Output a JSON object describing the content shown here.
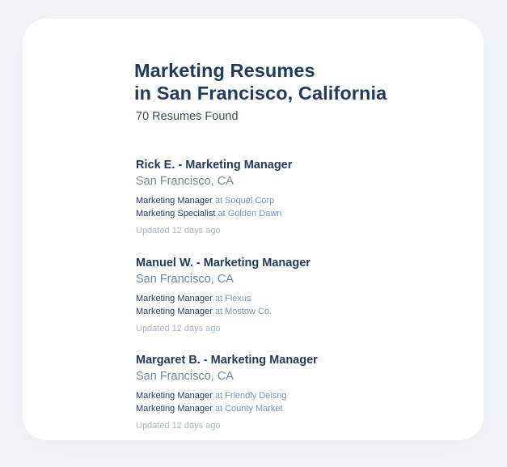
{
  "page": {
    "title_line1": "Marketing Resumes",
    "title_line2": "in San Francisco, California",
    "count_text": "70 Resumes Found"
  },
  "resumes": [
    {
      "name": "Rick E. - Marketing Manager",
      "location": "San Francisco, CA",
      "jobs": [
        {
          "title": "Marketing Manager",
          "company": "at Soquel Corp"
        },
        {
          "title": "Marketing Specialist",
          "company": "at Golden Dawn"
        }
      ],
      "updated": "Updated 12 days ago"
    },
    {
      "name": "Manuel W. - Marketing Manager",
      "location": "San Francisco, CA",
      "jobs": [
        {
          "title": "Marketing Manager",
          "company": "at Flexus"
        },
        {
          "title": "Marketing Manager",
          "company": "at Mostow Co."
        }
      ],
      "updated": "Updated 12 days ago"
    },
    {
      "name": "Margaret B. - Marketing Manager",
      "location": "San Francisco, CA",
      "jobs": [
        {
          "title": "Marketing Manager",
          "company": "at Friendly Deisng"
        },
        {
          "title": "Marketing Manager",
          "company": "at County Market"
        }
      ],
      "updated": "Updated 12 days ago"
    }
  ],
  "colors": {
    "background": "#f3f6f9",
    "card": "#ffffff",
    "heading": "#233b5a",
    "location": "#6f87a6",
    "company": "#7b93b0",
    "muted": "#a8b6c7"
  }
}
